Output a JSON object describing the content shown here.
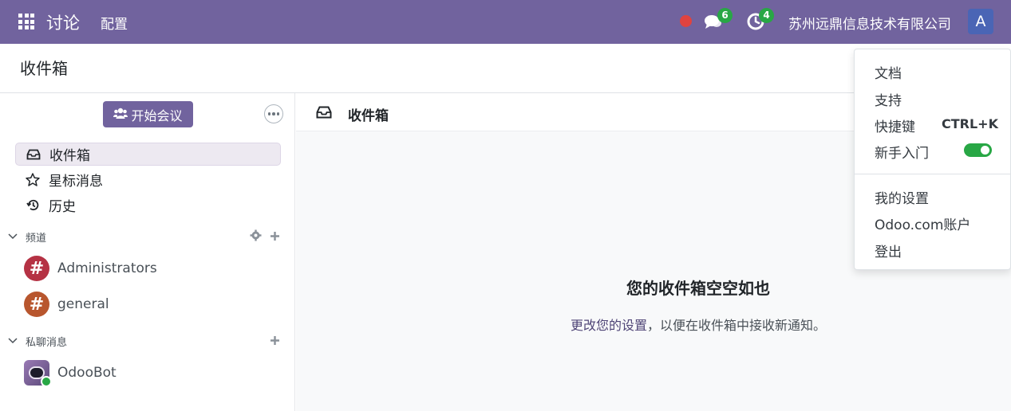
{
  "navbar": {
    "app_name": "讨论",
    "menu_config": "配置",
    "messages_badge": "6",
    "activities_badge": "4",
    "company": "苏州远鼎信息技术有限公司",
    "user_initial": "A"
  },
  "control_panel": {
    "title": "收件箱"
  },
  "sidebar": {
    "start_meeting": "开始会议",
    "mailboxes": [
      {
        "label": "收件箱",
        "icon": "inbox-icon"
      },
      {
        "label": "星标消息",
        "icon": "star-icon"
      },
      {
        "label": "历史",
        "icon": "history-icon"
      }
    ],
    "channels_header": "频道",
    "channels": [
      {
        "name": "Administrators",
        "color": "#b53244"
      },
      {
        "name": "general",
        "color": "#b8562e"
      }
    ],
    "direct_header": "私聊消息",
    "direct": [
      {
        "name": "OdooBot"
      }
    ]
  },
  "main": {
    "thread_title": "收件箱",
    "empty_title": "您的收件箱空空如也",
    "empty_link": "更改您的设置",
    "empty_rest": "，以便在收件箱中接收新通知。"
  },
  "user_menu": {
    "documentation": "文档",
    "support": "支持",
    "shortcuts": "快捷键",
    "shortcuts_kbd": "CTRL+K",
    "onboarding": "新手入门",
    "onboarding_on": true,
    "preferences": "我的设置",
    "account": "Odoo.com账户",
    "logout": "登出"
  },
  "colors": {
    "brand": "#71639e",
    "success": "#28a745",
    "recording": "#e0433f"
  }
}
